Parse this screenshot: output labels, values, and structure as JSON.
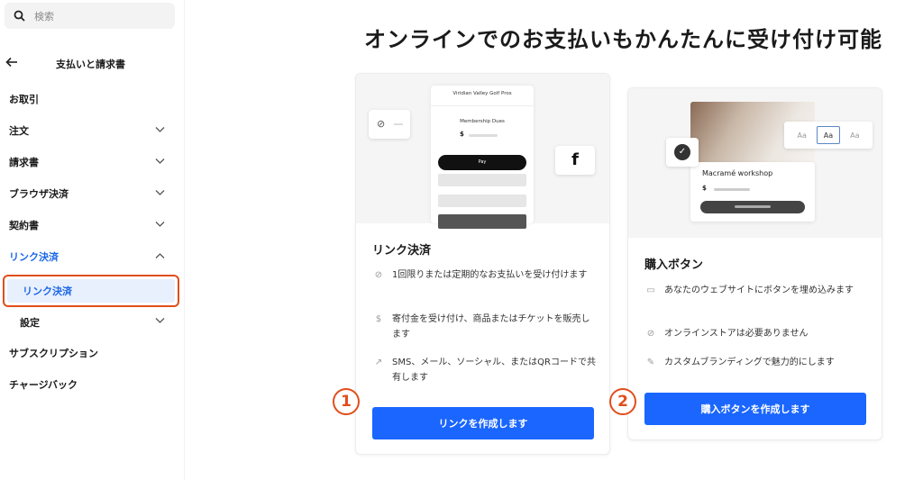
{
  "sidebar": {
    "search_placeholder": "検索",
    "back_title": "支払いと請求書",
    "items": [
      {
        "label": "お取引"
      },
      {
        "label": "注文"
      },
      {
        "label": "請求書"
      },
      {
        "label": "ブラウザ決済"
      },
      {
        "label": "契約書"
      },
      {
        "label": "リンク決済"
      },
      {
        "label": "リンク決済"
      },
      {
        "label": "設定"
      },
      {
        "label": "サブスクリプション"
      },
      {
        "label": "チャージバック"
      }
    ]
  },
  "main": {
    "heading": "オンラインでのお支払いもかんたんに受け付け可能",
    "cards": [
      {
        "title": "リンク決済",
        "badge": "1",
        "mock": {
          "store": "Viridian Valley Golf Pros",
          "item": "Membership Dues",
          "currency": "$",
          "pay_label": "Pay",
          "social_icon": "f"
        },
        "features": [
          {
            "icon": "link-icon",
            "glyph": "⊘",
            "text": "1回限りまたは定期的なお支払いを受け付けます"
          },
          {
            "icon": "dollar-icon",
            "glyph": "$",
            "text": "寄付金を受け付け、商品またはチケットを販売します"
          },
          {
            "icon": "share-arrow-icon",
            "glyph": "↗",
            "text": "SMS、メール、ソーシャル、またはQRコードで共有します"
          }
        ],
        "button": "リンクを作成します"
      },
      {
        "title": "購入ボタン",
        "badge": "2",
        "mock": {
          "item": "Macramé workshop",
          "currency": "$",
          "font_options": [
            "Aa",
            "Aa",
            "Aa"
          ]
        },
        "features": [
          {
            "icon": "embed-icon",
            "glyph": "▭",
            "text": "あなたのウェブサイトにボタンを埋め込みます"
          },
          {
            "icon": "no-store-icon",
            "glyph": "⊘",
            "text": "オンラインストアは必要ありません"
          },
          {
            "icon": "brush-icon",
            "glyph": "✎",
            "text": "カスタムブランディングで魅力的にします"
          }
        ],
        "button": "購入ボタンを作成します"
      }
    ]
  }
}
